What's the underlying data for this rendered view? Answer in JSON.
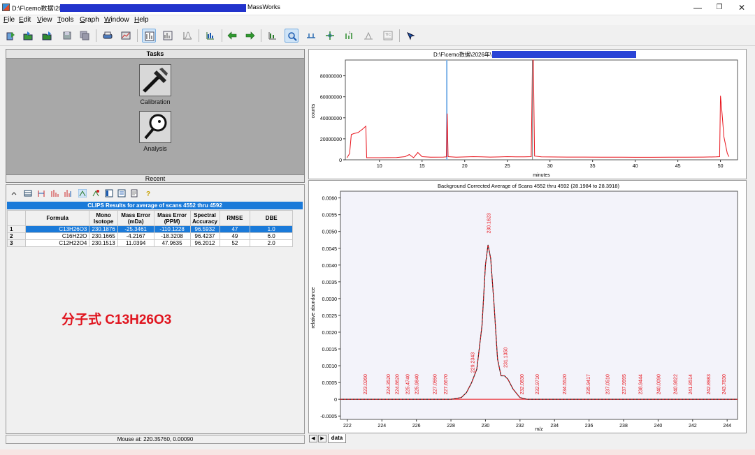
{
  "window": {
    "path": "D:\\F\\cemo数据\\20",
    "app_name": "MassWorks",
    "minimize_glyph": "—",
    "maximize_glyph": "❐",
    "close_glyph": "✕"
  },
  "menu": [
    "File",
    "Edit",
    "View",
    "Tools",
    "Graph",
    "Window",
    "Help"
  ],
  "menu_accel": [
    "F",
    "E",
    "V",
    "T",
    "G",
    "W",
    "H"
  ],
  "tasks": {
    "header": "Tasks",
    "calibration_label": "Calibration",
    "analysis_label": "Analysis",
    "recent_header": "Recent"
  },
  "clips": {
    "title": "CLIPS Results for average of scans 4552 thru 4592",
    "columns": [
      "Formula",
      "Mono Isotope",
      "Mass Error (mDa)",
      "Mass Error (PPM)",
      "Spectral Accuracy",
      "RMSE",
      "DBE"
    ],
    "rows": [
      {
        "n": "1",
        "formula": "C13H26O3",
        "mono": "230.1876",
        "err_mda": "-25.3461",
        "err_ppm": "-110.1228",
        "spec": "96.5932",
        "rmse": "47",
        "dbe": "1.0"
      },
      {
        "n": "2",
        "formula": "C16H22O",
        "mono": "230.1665",
        "err_mda": "-4.2167",
        "err_ppm": "-18.3208",
        "spec": "96.4237",
        "rmse": "49",
        "dbe": "6.0"
      },
      {
        "n": "3",
        "formula": "C12H22O4",
        "mono": "230.1513",
        "err_mda": "11.0394",
        "err_ppm": "47.9635",
        "spec": "96.2012",
        "rmse": "52",
        "dbe": "2.0"
      }
    ]
  },
  "annotation": "分子式 C13H26O3",
  "status": {
    "mouse": "Mouse at: 220.35760, 0.00090"
  },
  "tab": {
    "label": "data"
  },
  "chart_data": [
    {
      "type": "line",
      "title": "D:\\F\\cemo数据\\2026年\\",
      "xlabel": "minutes",
      "ylabel": "counts",
      "xlim": [
        6,
        52
      ],
      "ylim": [
        0,
        95000000
      ],
      "xticks": [
        10,
        15,
        20,
        25,
        30,
        35,
        40,
        45,
        50
      ],
      "yticks": [
        0,
        20000000,
        40000000,
        60000000,
        80000000
      ],
      "ytick_labels": [
        "0",
        "20000000",
        "40000000",
        "60000000",
        "80000000"
      ],
      "series_color": "#e8141c",
      "marker_color": "#7db3e8",
      "marker_x": 17.9,
      "points": [
        [
          6.2,
          2000000
        ],
        [
          6.5,
          6000000
        ],
        [
          6.7,
          24000000
        ],
        [
          7.0,
          25000000
        ],
        [
          7.5,
          26000000
        ],
        [
          8.0,
          29000000
        ],
        [
          8.4,
          32000000
        ],
        [
          8.5,
          2000000
        ],
        [
          10,
          2000000
        ],
        [
          12,
          2200000
        ],
        [
          13,
          3000000
        ],
        [
          13.5,
          5000000
        ],
        [
          14,
          2000000
        ],
        [
          14.5,
          7000000
        ],
        [
          15,
          3000000
        ],
        [
          16,
          2500000
        ],
        [
          17.5,
          2600000
        ],
        [
          17.85,
          2800000
        ],
        [
          17.95,
          44000000
        ],
        [
          18.05,
          3000000
        ],
        [
          19,
          2500000
        ],
        [
          20,
          2700000
        ],
        [
          21,
          3000000
        ],
        [
          22,
          2800000
        ],
        [
          23,
          2600000
        ],
        [
          24,
          2700000
        ],
        [
          25,
          3000000
        ],
        [
          26,
          2800000
        ],
        [
          27,
          2800000
        ],
        [
          27.8,
          3000000
        ],
        [
          27.95,
          95000000
        ],
        [
          28.05,
          95000000
        ],
        [
          28.2,
          3500000
        ],
        [
          29,
          2800000
        ],
        [
          30,
          2700000
        ],
        [
          32,
          2600000
        ],
        [
          34,
          2600000
        ],
        [
          36,
          2500000
        ],
        [
          38,
          2500000
        ],
        [
          40,
          2400000
        ],
        [
          42,
          2400000
        ],
        [
          44,
          2500000
        ],
        [
          46,
          2500000
        ],
        [
          48,
          2600000
        ],
        [
          49.5,
          2800000
        ],
        [
          49.9,
          3000000
        ],
        [
          50.0,
          61000000
        ],
        [
          50.15,
          48000000
        ],
        [
          50.4,
          22000000
        ],
        [
          50.8,
          6000000
        ],
        [
          51,
          3000000
        ]
      ]
    },
    {
      "type": "line",
      "title": "Background Corrected Average of Scans 4552 thru 4592 (28.1984 to 28.3918)",
      "xlabel": "m/z",
      "ylabel": "relative abundance",
      "xlim": [
        221.6,
        244.6
      ],
      "ylim": [
        -0.0006,
        0.0062
      ],
      "xticks": [
        222,
        224,
        226,
        228,
        230,
        232,
        234,
        236,
        238,
        240,
        242,
        244
      ],
      "yticks": [
        -0.0005,
        0,
        0.0005,
        0.001,
        0.0015,
        0.002,
        0.0025,
        0.003,
        0.0035,
        0.004,
        0.0045,
        0.005,
        0.0055,
        0.006
      ],
      "ytick_labels": [
        "-0.0005",
        "0",
        "0.0005",
        "0.0010",
        "0.0015",
        "0.0020",
        "0.0025",
        "0.0030",
        "0.0035",
        "0.0040",
        "0.0045",
        "0.0050",
        "0.0055",
        "0.0060"
      ],
      "measured_color": "#222222",
      "theoretical_color": "#e8141c",
      "points": [
        [
          221.6,
          0
        ],
        [
          228,
          0
        ],
        [
          228.6,
          5e-05
        ],
        [
          228.9,
          0.0002
        ],
        [
          229.2,
          0.0005
        ],
        [
          229.5,
          0.0009
        ],
        [
          229.8,
          0.0022
        ],
        [
          230.0,
          0.004
        ],
        [
          230.15,
          0.0046
        ],
        [
          230.3,
          0.0042
        ],
        [
          230.5,
          0.0028
        ],
        [
          230.7,
          0.0012
        ],
        [
          230.9,
          0.0007
        ],
        [
          231.1,
          0.0007
        ],
        [
          231.3,
          0.0006
        ],
        [
          231.6,
          0.0003
        ],
        [
          232.0,
          5e-05
        ],
        [
          232.4,
          0
        ],
        [
          244.6,
          0
        ]
      ],
      "peak_labels": [
        {
          "x": 223.026,
          "label": "223.0260"
        },
        {
          "x": 224.352,
          "label": "224.3520"
        },
        {
          "x": 224.862,
          "label": "224.8620"
        },
        {
          "x": 225.474,
          "label": "225.4740"
        },
        {
          "x": 225.984,
          "label": "225.9840"
        },
        {
          "x": 227.055,
          "label": "227.0550"
        },
        {
          "x": 227.667,
          "label": "227.6670"
        },
        {
          "x": 229.2343,
          "label": "229.2343",
          "y": 0.00075
        },
        {
          "x": 230.1623,
          "label": "230.1623",
          "y": 0.0049
        },
        {
          "x": 231.135,
          "label": "231.1350",
          "y": 0.0009
        },
        {
          "x": 232.083,
          "label": "232.0830"
        },
        {
          "x": 232.971,
          "label": "232.9710"
        },
        {
          "x": 234.552,
          "label": "234.5520"
        },
        {
          "x": 235.9417,
          "label": "235.9417"
        },
        {
          "x": 237.051,
          "label": "237.0510"
        },
        {
          "x": 237.9995,
          "label": "237.9995"
        },
        {
          "x": 238.9444,
          "label": "238.9444"
        },
        {
          "x": 240.009,
          "label": "240.0090"
        },
        {
          "x": 240.9822,
          "label": "240.9822"
        },
        {
          "x": 241.8514,
          "label": "241.8514"
        },
        {
          "x": 242.8983,
          "label": "242.8983"
        },
        {
          "x": 243.783,
          "label": "243.7830"
        }
      ]
    }
  ]
}
